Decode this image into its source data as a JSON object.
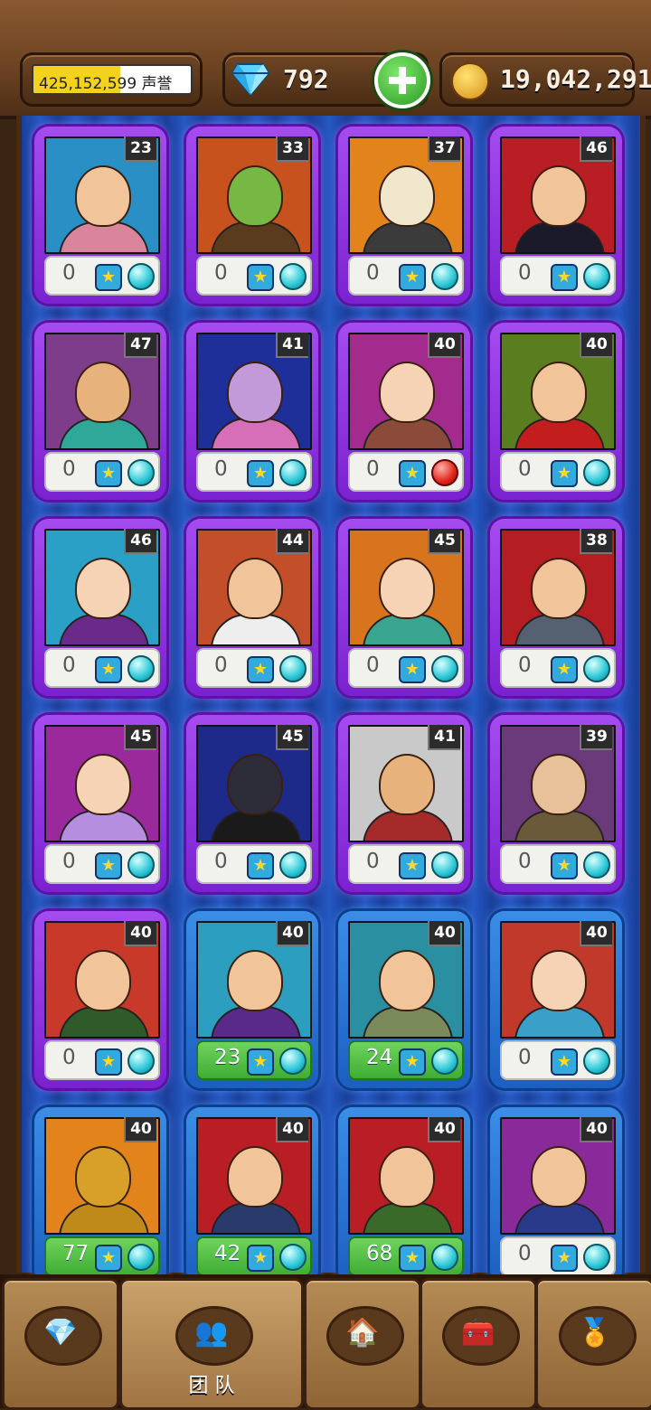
{
  "header": {
    "fame_value": "425,152,599",
    "fame_label": "声誉",
    "fame_fill": 0.55,
    "gems": "792",
    "gold": "19,042,291"
  },
  "cards": [
    {
      "level": "23",
      "stars": "0",
      "frame": "purple",
      "orb": "cyan",
      "bg": "#2a8fc4",
      "skin": "#f1c49a",
      "cloth": "#d9849a"
    },
    {
      "level": "33",
      "stars": "0",
      "frame": "purple",
      "orb": "cyan",
      "bg": "#c8521d",
      "skin": "#76b843",
      "cloth": "#5a3b1e"
    },
    {
      "level": "37",
      "stars": "0",
      "frame": "purple",
      "orb": "cyan",
      "bg": "#e2841b",
      "skin": "#efe6cc",
      "cloth": "#3b3b3b"
    },
    {
      "level": "46",
      "stars": "0",
      "frame": "purple",
      "orb": "cyan",
      "bg": "#b81e24",
      "skin": "#f1c49a",
      "cloth": "#1a1a2a"
    },
    {
      "level": "47",
      "stars": "0",
      "frame": "purple",
      "orb": "cyan",
      "bg": "#7d3d8a",
      "skin": "#e7b27c",
      "cloth": "#2fa89a"
    },
    {
      "level": "41",
      "stars": "0",
      "frame": "purple",
      "orb": "cyan",
      "bg": "#1f2f9a",
      "skin": "#c39ad9",
      "cloth": "#d66fb8"
    },
    {
      "level": "40",
      "stars": "0",
      "frame": "purple",
      "orb": "red",
      "bg": "#a32b8e",
      "skin": "#f6d3b5",
      "cloth": "#8b4a3a"
    },
    {
      "level": "40",
      "stars": "0",
      "frame": "purple",
      "orb": "cyan",
      "bg": "#5a7d1f",
      "skin": "#f1c49a",
      "cloth": "#c21e1e"
    },
    {
      "level": "46",
      "stars": "0",
      "frame": "purple",
      "orb": "cyan",
      "bg": "#2ba0c6",
      "skin": "#f6d3b5",
      "cloth": "#6b2a8a"
    },
    {
      "level": "44",
      "stars": "0",
      "frame": "purple",
      "orb": "cyan",
      "bg": "#c24e2a",
      "skin": "#f1c49a",
      "cloth": "#eeeeee"
    },
    {
      "level": "45",
      "stars": "0",
      "frame": "purple",
      "orb": "cyan",
      "bg": "#d8741d",
      "skin": "#f6d3b5",
      "cloth": "#3aa58f"
    },
    {
      "level": "38",
      "stars": "0",
      "frame": "purple",
      "orb": "cyan",
      "bg": "#b41e22",
      "skin": "#f1c49a",
      "cloth": "#556070"
    },
    {
      "level": "45",
      "stars": "0",
      "frame": "purple",
      "orb": "cyan",
      "bg": "#9a2a9c",
      "skin": "#f6d3b5",
      "cloth": "#b58ee0"
    },
    {
      "level": "45",
      "stars": "0",
      "frame": "purple",
      "orb": "cyan",
      "bg": "#1d2a8a",
      "skin": "#2d2d3a",
      "cloth": "#1a1a1a"
    },
    {
      "level": "41",
      "stars": "0",
      "frame": "purple",
      "orb": "cyan",
      "bg": "#c9c9c9",
      "skin": "#e7b27c",
      "cloth": "#a52a2a"
    },
    {
      "level": "39",
      "stars": "0",
      "frame": "purple",
      "orb": "cyan",
      "bg": "#6a3a7a",
      "skin": "#e8c19a",
      "cloth": "#6b5a3a"
    },
    {
      "level": "40",
      "stars": "0",
      "frame": "purple",
      "orb": "cyan",
      "bg": "#c8392a",
      "skin": "#f1c49a",
      "cloth": "#2f5a2a"
    },
    {
      "level": "40",
      "stars": "23",
      "frame": "blue",
      "orb": "cyan",
      "bg": "#2c9ec0",
      "skin": "#f1c49a",
      "cloth": "#5a2a8a"
    },
    {
      "level": "40",
      "stars": "24",
      "frame": "blue",
      "orb": "cyan",
      "bg": "#2a8fa0",
      "skin": "#f1c49a",
      "cloth": "#7a8a5a"
    },
    {
      "level": "40",
      "stars": "0",
      "frame": "blue",
      "orb": "cyan",
      "bg": "#c0392b",
      "skin": "#f6d3b5",
      "cloth": "#3aa0c8"
    },
    {
      "level": "40",
      "stars": "77",
      "frame": "blue",
      "orb": "cyan",
      "bg": "#e2841b",
      "skin": "#d8a028",
      "cloth": "#c08a1a"
    },
    {
      "level": "40",
      "stars": "42",
      "frame": "blue",
      "orb": "cyan",
      "bg": "#b81e24",
      "skin": "#f1c49a",
      "cloth": "#2a3a6a"
    },
    {
      "level": "40",
      "stars": "68",
      "frame": "blue",
      "orb": "cyan",
      "bg": "#b81e24",
      "skin": "#f1c49a",
      "cloth": "#3a6a2a"
    },
    {
      "level": "40",
      "stars": "0",
      "frame": "blue",
      "orb": "cyan",
      "bg": "#8a2a9a",
      "skin": "#f1c49a",
      "cloth": "#2a3a8a"
    }
  ],
  "nav": [
    {
      "icon": "gems-icon",
      "glyph": "💎",
      "label": ""
    },
    {
      "icon": "team-icon",
      "glyph": "👥",
      "label": "团 队"
    },
    {
      "icon": "buildings-icon",
      "glyph": "🏠",
      "label": ""
    },
    {
      "icon": "treasure-chest-icon",
      "glyph": "🧰",
      "label": ""
    },
    {
      "icon": "medal-icon",
      "glyph": "🏅",
      "label": ""
    }
  ]
}
